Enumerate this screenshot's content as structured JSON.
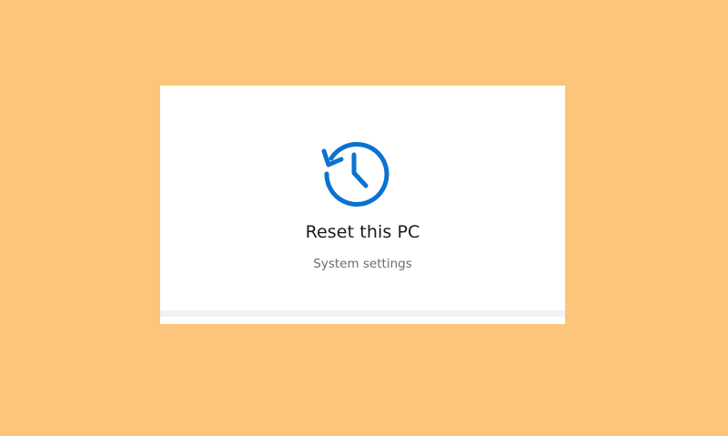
{
  "colors": {
    "background": "#fbc67b",
    "card": "#ffffff",
    "accent": "#0a72d1",
    "title": "#1a1a1a",
    "subtitle": "#6b6b6b"
  },
  "tile": {
    "icon": "history-reset-icon",
    "title": "Reset this PC",
    "subtitle": "System settings"
  }
}
